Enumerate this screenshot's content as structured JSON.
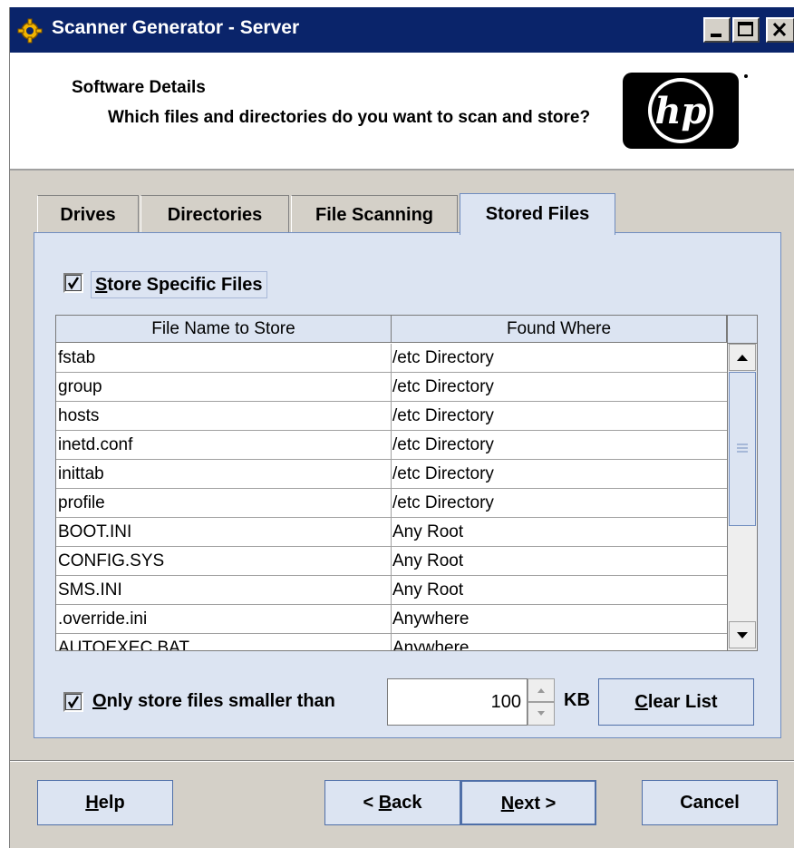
{
  "window": {
    "title": "Scanner Generator - Server"
  },
  "header": {
    "title": "Software Details",
    "description": "Which files and directories do you want to scan and store?",
    "logo_text": "hp"
  },
  "tabs": [
    {
      "label": "Drives",
      "active": false
    },
    {
      "label": "Directories",
      "active": false
    },
    {
      "label": "File Scanning",
      "active": false
    },
    {
      "label": "Stored Files",
      "active": true
    }
  ],
  "stored_files": {
    "store_specific": {
      "label_first": "S",
      "label_rest": "tore Specific Files",
      "checked": true
    },
    "table": {
      "columns": [
        "File Name to Store",
        "Found Where"
      ],
      "rows": [
        [
          "fstab",
          "/etc Directory"
        ],
        [
          "group",
          "/etc Directory"
        ],
        [
          "hosts",
          "/etc Directory"
        ],
        [
          "inetd.conf",
          "/etc Directory"
        ],
        [
          "inittab",
          "/etc Directory"
        ],
        [
          "profile",
          "/etc Directory"
        ],
        [
          "BOOT.INI",
          "Any Root"
        ],
        [
          "CONFIG.SYS",
          "Any Root"
        ],
        [
          "SMS.INI",
          "Any Root"
        ],
        [
          ".override.ini",
          "Anywhere"
        ],
        [
          "AUTOEXEC.BAT",
          "Anywhere"
        ]
      ]
    },
    "size_limit": {
      "label_first": "O",
      "label_rest": "nly store files smaller than",
      "checked": true,
      "value": "100",
      "unit": "KB"
    },
    "clear_list": {
      "label_first": "C",
      "label_rest": "lear List"
    }
  },
  "footer": {
    "help": {
      "label_first": "H",
      "label_rest": "elp"
    },
    "back": {
      "prefix": "< ",
      "label_first": "B",
      "label_rest": "ack"
    },
    "next": {
      "label_first": "N",
      "label_rest": "ext >"
    },
    "cancel": "Cancel"
  },
  "colors": {
    "titlebar": "#0a246a",
    "panel": "#dce4f2",
    "accent_border": "#6f8cbf",
    "window_bg": "#d4d0c8"
  }
}
